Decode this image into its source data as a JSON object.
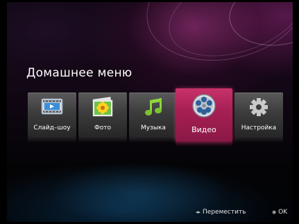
{
  "home_menu": {
    "title": "Домашнее меню",
    "items": [
      {
        "label": "Слайд–шоу",
        "icon": "slideshow-film-icon",
        "selected": false
      },
      {
        "label": "Фото",
        "icon": "photo-flower-icon",
        "selected": false
      },
      {
        "label": "Музыка",
        "icon": "music-note-icon",
        "selected": false
      },
      {
        "label": "Видео",
        "icon": "film-reel-icon",
        "selected": true
      },
      {
        "label": "Настройка",
        "icon": "gear-icon",
        "selected": false
      }
    ]
  },
  "footer": {
    "move_glyph": "◂▸",
    "move_label": "Переместить",
    "ok_glyph": "◉",
    "ok_label": "OK"
  },
  "colors": {
    "selected_tile": "#a82055",
    "tile": "#3c3c3c",
    "text": "#ffffff"
  }
}
